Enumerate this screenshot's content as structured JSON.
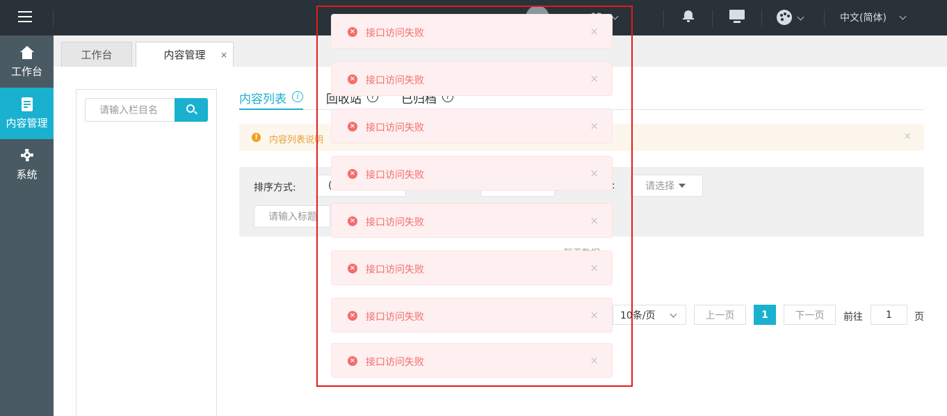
{
  "header": {
    "user_name": "",
    "user_suffix": "n02",
    "language": "中文(简体)"
  },
  "sidebar": {
    "items": [
      {
        "label": "工作台",
        "icon": "home-icon"
      },
      {
        "label": "内容管理",
        "icon": "document-icon"
      },
      {
        "label": "系统",
        "icon": "gear-icon"
      }
    ]
  },
  "tabs": {
    "workbench": "工作台",
    "content": "内容管理",
    "close": "×"
  },
  "column_search": {
    "placeholder": "请输入栏目名"
  },
  "content_tabs": [
    {
      "label": "内容列表",
      "info": "i"
    },
    {
      "label": "回收站",
      "info": "i"
    },
    {
      "label": "已归档",
      "info": "i"
    }
  ],
  "notice": {
    "icon_text": "!",
    "text": "内容列表说明",
    "close": "×"
  },
  "filters": {
    "sort_label": "排序方式:",
    "sort_value_prefix": "(",
    "status_label": ":",
    "select_placeholder": "请选择",
    "title_placeholder": "请输入标题"
  },
  "empty_text": "暂无数据",
  "pagination": {
    "page_size": "10条/页",
    "prev": "上一页",
    "current_page": "1",
    "next": "下一页",
    "goto_label": "前往",
    "goto_value": "1",
    "page_unit": "页"
  },
  "messages": {
    "icon_text": "×",
    "close": "×",
    "items": [
      {
        "text": "接口访问失败"
      },
      {
        "text": "接口访问失败"
      },
      {
        "text": "接口访问失败"
      },
      {
        "text": "接口访问失败"
      },
      {
        "text": "接口访问失败"
      },
      {
        "text": "接口访问失败"
      },
      {
        "text": "接口访问失败"
      },
      {
        "text": "接口访问失败"
      }
    ]
  },
  "colors": {
    "accent": "#1ab1d0",
    "header_bg": "#283238",
    "sidebar_bg": "#4a5a62",
    "error_text": "#f56c6c",
    "error_bg": "#fef0f0",
    "warning_text": "#e6a23c",
    "highlight_border": "#e01b1b"
  }
}
